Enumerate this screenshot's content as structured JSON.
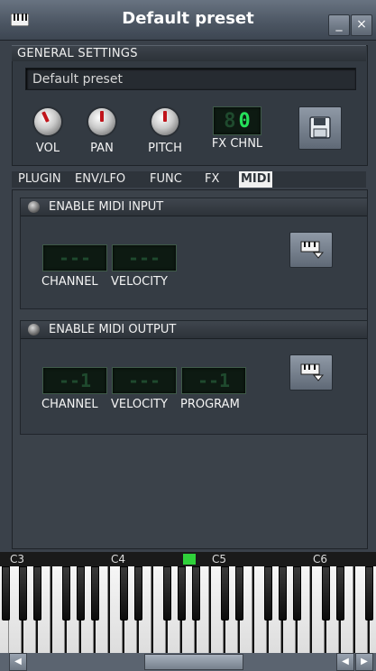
{
  "window": {
    "title": "Default preset",
    "minimize_label": "_",
    "close_label": "×"
  },
  "general": {
    "header": "GENERAL SETTINGS",
    "preset_name": "Default preset",
    "knobs": [
      {
        "label": "VOL"
      },
      {
        "label": "PAN"
      },
      {
        "label": "PITCH"
      }
    ],
    "fx_channel": {
      "label": "FX CHNL",
      "value": "0"
    }
  },
  "tabs": [
    {
      "label": "PLUGIN",
      "active": false
    },
    {
      "label": "ENV/LFO",
      "active": false
    },
    {
      "label": "FUNC",
      "active": false
    },
    {
      "label": "FX",
      "active": false
    },
    {
      "label": "MIDI",
      "active": true
    }
  ],
  "midi_input": {
    "title": "ENABLE MIDI INPUT",
    "channel_label": "CHANNEL",
    "velocity_label": "VELOCITY",
    "channel_digits": "---",
    "velocity_digits": "---"
  },
  "midi_output": {
    "title": "ENABLE MIDI OUTPUT",
    "channel_label": "CHANNEL",
    "velocity_label": "VELOCITY",
    "program_label": "PROGRAM",
    "channel_digits": "--1",
    "velocity_digits": "---",
    "program_digits": "--1"
  },
  "keyboard": {
    "octave_labels": [
      "C3",
      "C4",
      "C5",
      "C6"
    ],
    "marker_color": "#2fd13a"
  },
  "colors": {
    "lcd_on": "#25e05a",
    "knob_pointer": "#c0141b"
  }
}
